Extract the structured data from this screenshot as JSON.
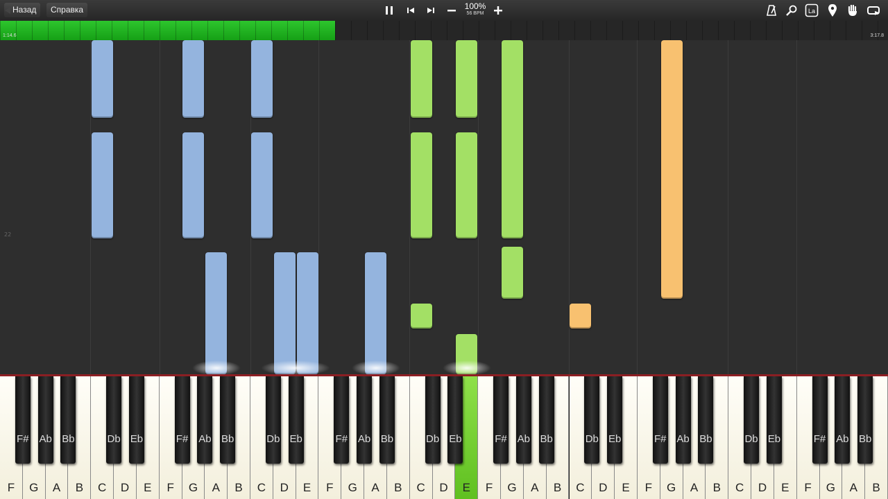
{
  "toolbar": {
    "back_label": "Назад",
    "help_label": "Справка",
    "zoom_label": "100%",
    "bpm_label": "56 BPM",
    "icons": [
      "pause-icon",
      "skip-back-icon",
      "skip-forward-icon",
      "minus-icon",
      "plus-icon",
      "metronome-icon",
      "magnifier-icon",
      "note-label-icon",
      "location-pin-icon",
      "hand-icon",
      "loop-icon"
    ]
  },
  "progress": {
    "current_time": "1:14.6",
    "total_time": "3:17.8",
    "fraction": 0.377,
    "fill_color": "#2dc52d"
  },
  "roll": {
    "measure_number": "22",
    "note_colors": {
      "blue": "#94b4de",
      "green": "#a3e065",
      "orange": "#f8c170"
    }
  },
  "keyboard": {
    "white_keys": [
      "F",
      "G",
      "A",
      "B",
      "C",
      "D",
      "E",
      "F",
      "G",
      "A",
      "B",
      "C",
      "D",
      "E",
      "F",
      "G",
      "A",
      "B",
      "C",
      "D",
      "E",
      "F",
      "G",
      "A",
      "B",
      "C",
      "D",
      "E",
      "F",
      "G",
      "A",
      "B",
      "C",
      "D",
      "E",
      "F",
      "G",
      "A",
      "B",
      "C"
    ],
    "black_keys": [
      "F#",
      "Ab",
      "Bb",
      "Db",
      "Eb",
      "F#",
      "Ab",
      "Bb",
      "Db",
      "Eb",
      "F#",
      "Ab",
      "Bb",
      "Db",
      "Eb",
      "F#",
      "Ab",
      "Bb",
      "Db",
      "Eb",
      "F#",
      "Ab",
      "Bb",
      "Db",
      "Eb",
      "F#",
      "Ab",
      "Bb"
    ],
    "active_white_index": 20,
    "active_color": "#7ed13a"
  }
}
